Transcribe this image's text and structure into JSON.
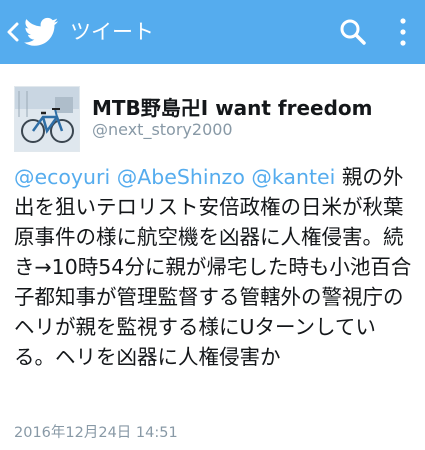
{
  "header": {
    "title": "ツイート",
    "background": "#55acee"
  },
  "icons": {
    "back": "chevron-left-icon",
    "logo": "twitter-bird-icon",
    "search": "search-icon",
    "more": "more-vertical-icon"
  },
  "tweet": {
    "display_name": "MTB野島卍I want freedom",
    "handle": "@next_story2000",
    "mentions": [
      "@ecoyuri",
      "@AbeShinzo",
      "@kantei"
    ],
    "body": "親の外出を狙いテロリスト安倍政権の日米が秋葉原事件の様に航空機を凶器に人権侵害。続き→10時54分に親が帰宅した時も小池百合子都知事が管理監督する管轄外の警視庁のヘリが親を監視する様にUターンしている。ヘリを凶器に人権侵害か",
    "timestamp": "2016年12月24日 14:51",
    "mention_color": "#55acee"
  }
}
